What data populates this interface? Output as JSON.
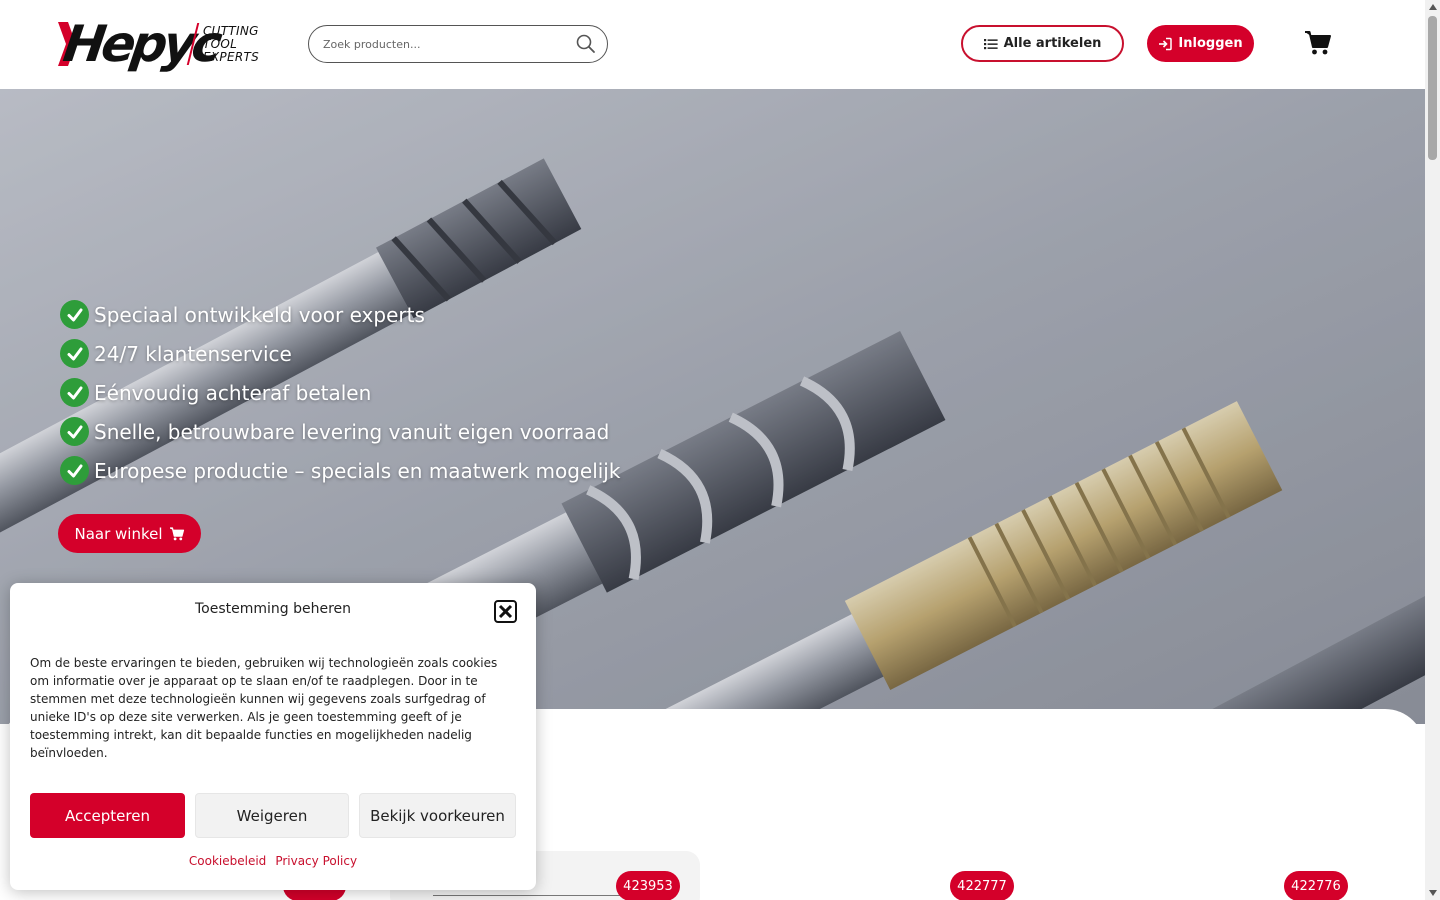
{
  "header": {
    "logo_word": "Hepyc",
    "logo_tagline": [
      "CUTTING",
      "TOOL",
      "EXPERTS"
    ],
    "search_placeholder": "Zoek producten...",
    "search_icon": "search-icon",
    "all_items_label": "Alle artikelen",
    "all_items_icon": "list-icon",
    "login_label": "Inloggen",
    "login_icon": "sign-in-icon",
    "cart_icon": "shopping-cart-icon"
  },
  "hero": {
    "features": [
      "Speciaal ontwikkeld voor experts",
      "24/7 klantenservice",
      "Eénvoudig achteraf betalen",
      "Snelle, betrouwbare levering vanuit eigen voorraad",
      "Europese productie – specials en maatwerk mogelijk"
    ],
    "shop_button_label": "Naar winkel",
    "shop_button_icon": "shopping-cart-icon"
  },
  "products": {
    "badges": [
      "423953",
      "422777",
      "422776"
    ]
  },
  "consent": {
    "title": "Toestemming beheren",
    "body": "Om de beste ervaringen te bieden, gebruiken wij technologieën zoals cookies om informatie over je apparaat op te slaan en/of te raadplegen. Door in te stemmen met deze technologieën kunnen wij gegevens zoals surfgedrag of unieke ID's op deze site verwerken. Als je geen toestemming geeft of je toestemming intrekt, kan dit bepaalde functies en mogelijkheden nadelig beïnvloeden.",
    "accept_label": "Accepteren",
    "deny_label": "Weigeren",
    "preferences_label": "Bekijk voorkeuren",
    "cookie_policy_label": "Cookiebeleid",
    "privacy_policy_label": "Privacy Policy"
  },
  "colors": {
    "brand_red": "#d4002a",
    "check_green": "#2e9d3a"
  }
}
